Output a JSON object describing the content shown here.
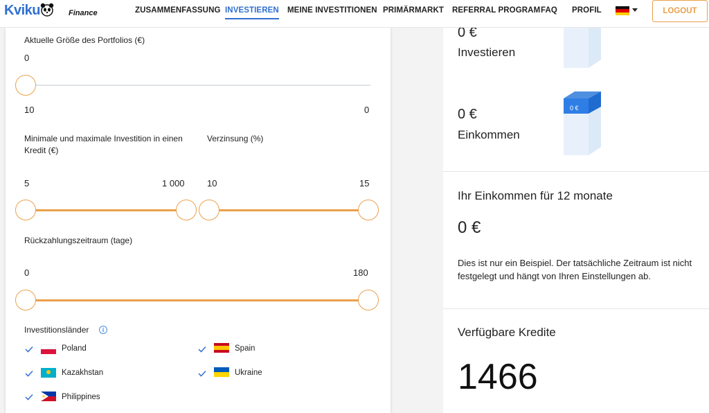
{
  "header": {
    "logo_text": "Kviku",
    "logo_sub": "Finance",
    "nav": [
      {
        "label": "ZUSAMMENFASSUNG",
        "active": false
      },
      {
        "label": "INVESTIEREN",
        "active": true
      },
      {
        "label": "MEINE INVESTITIONEN",
        "active": false
      },
      {
        "label": "PRIMÄRMARKT",
        "active": false
      },
      {
        "label": "REFERRAL PROGRAM",
        "active": false
      },
      {
        "label": "FAQ",
        "active": false
      },
      {
        "label": "PROFIL",
        "active": false
      }
    ],
    "language_icon": "germany-flag-icon",
    "logout_label": "LOGOUT"
  },
  "filters": {
    "portfolio": {
      "label": "Aktuelle Größe des Portfolios (€)",
      "value": "0",
      "min_label": "10",
      "max_label": "0"
    },
    "investment_range": {
      "label": "Minimale und maximale Investition in einen Kredit (€)",
      "min": "5",
      "max": "1 000"
    },
    "interest": {
      "label": "Verzinsung (%)",
      "min": "10",
      "max": "15"
    },
    "repayment": {
      "label": "Rückzahlungszeitraum (tage)",
      "min": "0",
      "max": "180"
    },
    "countries": {
      "label": "Investitionsländer",
      "info_icon": "info-icon",
      "items": [
        {
          "name": "Poland",
          "checked": true
        },
        {
          "name": "Spain",
          "checked": true
        },
        {
          "name": "Kazakhstan",
          "checked": true
        },
        {
          "name": "Ukraine",
          "checked": true
        },
        {
          "name": "Philippines",
          "checked": true
        }
      ]
    }
  },
  "summary": {
    "invest_value": "0 €",
    "invest_label": "Investieren",
    "income_value": "0 €",
    "income_label": "Einkommen",
    "income_bar_label": "0 €",
    "income12_title": "Ihr Einkommen für 12 monate",
    "income12_value": "0 €",
    "disclaimer": "Dies ist nur ein Beispiel. Der tatsächliche Zeitraum ist nicht festgelegt und hängt von Ihren Einstellungen ab.",
    "loans_title": "Verfügbare Kredite",
    "loans_count": "1466"
  },
  "colors": {
    "accent_blue": "#2f6fd0",
    "accent_orange": "#eba04b"
  }
}
